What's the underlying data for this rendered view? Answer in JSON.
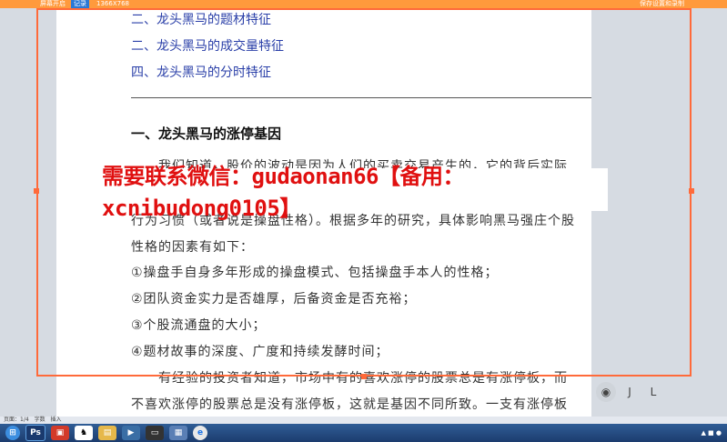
{
  "recorder": {
    "left_label": "屏幕开启",
    "mode_label": "记录",
    "resolution": "1366X768",
    "right_label": "保存设置和录制"
  },
  "document": {
    "toc": [
      "二、龙头黑马的题材特征",
      "二、龙头黑马的成交量特征",
      "四、龙头黑马的分时特征"
    ],
    "heading": "一、龙头黑马的涨停基因",
    "paragraph_lines": [
      "我们知道，股价的波动是因为人们的买卖交易产生的，它的背后实际",
      "行为习惯（或者说是操盘性格）。根据多年的研究，具体影响黑马强庄个股",
      "性格的因素有如下："
    ],
    "list_items": [
      "①操盘手自身多年形成的操盘模式、包括操盘手本人的性格；",
      "②团队资金实力是否雄厚，后备资金是否充裕；",
      "③个股流通盘的大小；",
      "④题材故事的深度、广度和持续发酵时间；"
    ],
    "closing_lines": [
      "有经验的投资者知道，市场中有的喜欢涨停的股票总是有涨停板，而",
      "不喜欢涨停的股票总是没有涨停板，这就是基因不同所致。一支有涨停板"
    ]
  },
  "banner": {
    "text": "需要联系微信：gudaonan66【备用：xcnibudong0105】",
    "color": "#e01010"
  },
  "controls": [
    "J",
    "L"
  ],
  "status_bar": {
    "page_info": "页面：1/4",
    "words": "字数",
    "mode": "插入"
  },
  "taskbar": {
    "icons": [
      "start-icon",
      "photoshop-icon",
      "app-icon",
      "horse-icon",
      "folder-icon",
      "player-icon",
      "video-icon",
      "app2-icon",
      "browser-icon"
    ],
    "tray": "▲ ■ ●"
  }
}
